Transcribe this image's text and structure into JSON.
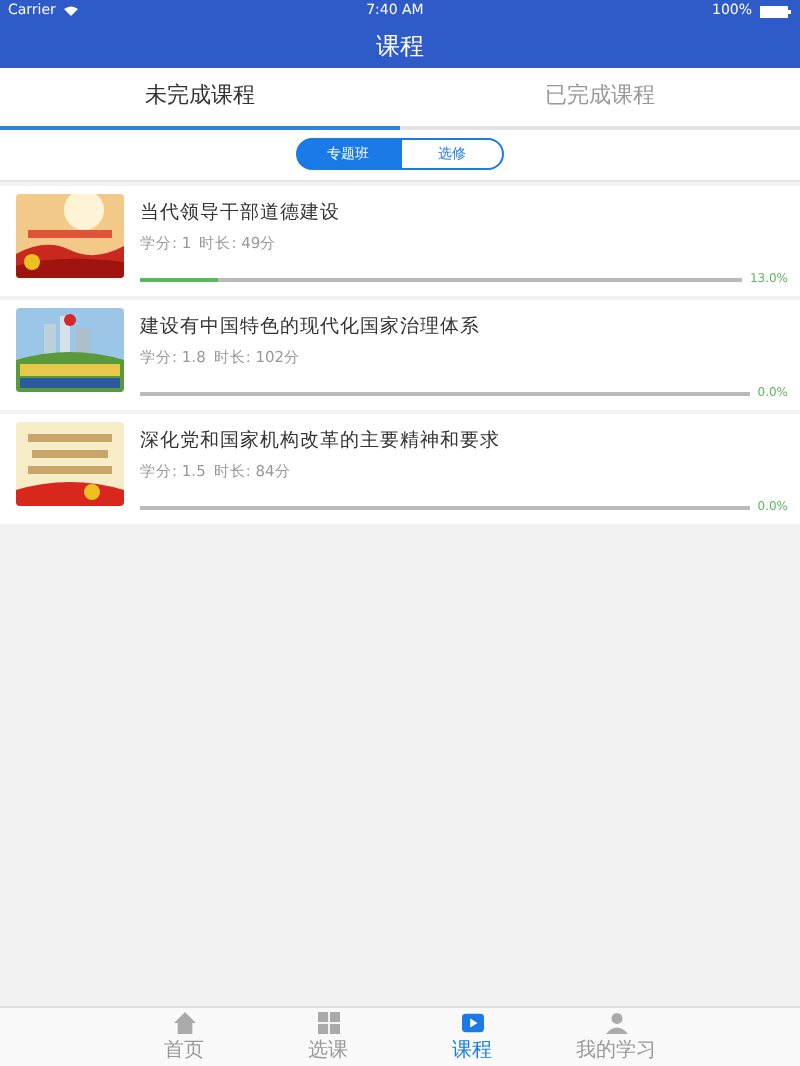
{
  "status_bar": {
    "carrier": "Carrier",
    "time": "7:40 AM",
    "battery": "100%"
  },
  "title": "课程",
  "tabs": [
    {
      "label": "未完成课程",
      "selected": true
    },
    {
      "label": "已完成课程",
      "selected": false
    }
  ],
  "segments": [
    {
      "label": "专题班",
      "selected": true
    },
    {
      "label": "选修",
      "selected": false
    }
  ],
  "courses": [
    {
      "title": "当代领导干部道德建设",
      "credit": "学分: 1",
      "duration": "时长: 49分",
      "level": 0.13,
      "percent": "13.0%",
      "kind": "picture"
    },
    {
      "title": "建设有中国特色的现代化国家治理体系",
      "credit": "学分: 1.8",
      "duration": "时长: 102分",
      "level": 0,
      "percent": "0.0%",
      "kind": "picture"
    },
    {
      "title": "深化党和国家机构改革的主要精神和要求",
      "credit": "学分: 1.5",
      "duration": "时长: 84分",
      "level": 0,
      "percent": "0.0%",
      "kind": "picture"
    }
  ],
  "tab_bar": [
    {
      "label": "首页",
      "kind": "home",
      "selected": false
    },
    {
      "label": "选课",
      "kind": "grid",
      "selected": false
    },
    {
      "label": "课程",
      "kind": "play",
      "selected": true
    },
    {
      "label": "我的学习",
      "kind": "person",
      "selected": false
    }
  ]
}
